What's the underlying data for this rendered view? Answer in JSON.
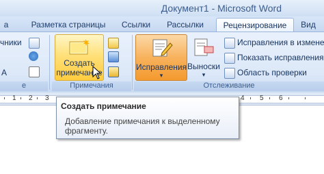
{
  "window": {
    "title": "Документ1 - Microsoft Word"
  },
  "tabs": [
    {
      "label": "а"
    },
    {
      "label": "Разметка страницы"
    },
    {
      "label": "Ссылки"
    },
    {
      "label": "Рассылки"
    },
    {
      "label": "Рецензирование"
    },
    {
      "label": "Вид"
    }
  ],
  "ribbon": {
    "left_group": {
      "item1": "чники",
      "item2": "А"
    },
    "comments": {
      "create_line1": "Создать",
      "create_line2": "примечание",
      "group_label": "Примечания"
    },
    "tracking": {
      "corrections_label": "Исправления",
      "balloons_label": "Выноски",
      "menu_items": [
        "Исправления в измене",
        "Показать исправления",
        "Область проверки"
      ],
      "group_label": "Отслеживание"
    },
    "left_group_label": "е"
  },
  "ruler": {
    "numbers": [
      "1",
      "2",
      "3",
      "4",
      "5",
      "6"
    ]
  },
  "tooltip": {
    "title": "Создать примечание",
    "description": "Добавление примечания к выделенному фрагменту."
  },
  "colors": {
    "accent": "#ffcc3f",
    "orange": "#f39a2f",
    "ribbon_bg": "#dce8f8"
  }
}
